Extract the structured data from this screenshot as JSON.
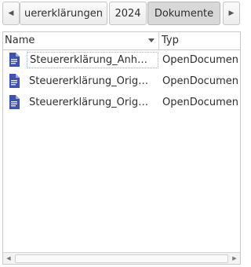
{
  "pathbar": {
    "left_arrow": "◀",
    "right_arrow": "▶",
    "crumbs": [
      {
        "label": "uererklärungen"
      },
      {
        "label": "2024"
      },
      {
        "label": "Dokumente",
        "active": true
      }
    ]
  },
  "columns": {
    "name": "Name",
    "type": "Typ"
  },
  "files": [
    {
      "name": "Steuererklärung_Anh…",
      "type": "OpenDocumen",
      "icon": "document-icon"
    },
    {
      "name": "Steuererklärung_Orig…",
      "type": "OpenDocumen",
      "icon": "document-icon"
    },
    {
      "name": "Steuererklärung_Orig…",
      "type": "OpenDocumen",
      "icon": "document-icon"
    }
  ],
  "scrollbar": {
    "left": "◀",
    "right": "▶"
  },
  "colors": {
    "doc_icon": "#3f51b5"
  }
}
